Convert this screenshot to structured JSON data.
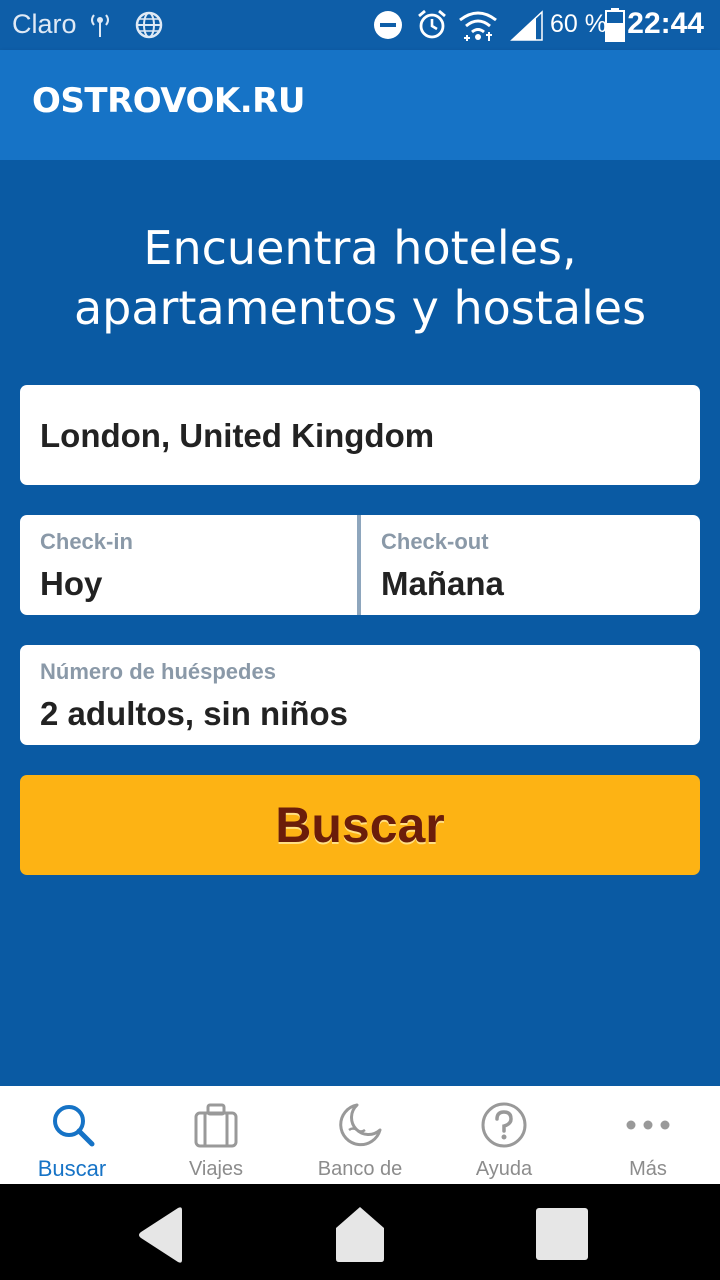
{
  "status_bar": {
    "carrier": "Claro",
    "battery_percent": "60 %",
    "time": "22:44",
    "icons": [
      "antenna-icon",
      "globe-icon",
      "do-not-disturb-icon",
      "alarm-icon",
      "wifi-icon",
      "cell-signal-icon",
      "battery-icon"
    ]
  },
  "app_bar": {
    "logo": "OSTROVOK.RU"
  },
  "hero": {
    "headline_line1": "Encuentra hoteles,",
    "headline_line2": "apartamentos y hostales"
  },
  "search_form": {
    "destination_value": "London, United Kingdom",
    "checkin_label": "Check-in",
    "checkin_value": "Hoy",
    "checkout_label": "Check-out",
    "checkout_value": "Mañana",
    "guests_label": "Número de huéspedes",
    "guests_value": "2 adultos, sin niños",
    "search_button": "Buscar"
  },
  "bottom_nav": {
    "items": [
      {
        "label": "Buscar",
        "icon": "search-icon",
        "active": true
      },
      {
        "label": "Viajes",
        "icon": "suitcase-icon",
        "active": false
      },
      {
        "label": "Banco de",
        "icon": "moon-icon",
        "active": false
      },
      {
        "label": "Ayuda",
        "icon": "help-icon",
        "active": false
      },
      {
        "label": "Más",
        "icon": "more-icon",
        "active": false
      }
    ]
  },
  "colors": {
    "primary_blue": "#0a5aa3",
    "app_bar_blue": "#1673c6",
    "button_yellow": "#fdb314",
    "button_text": "#6b1d0a",
    "active_nav": "#1673c6"
  }
}
